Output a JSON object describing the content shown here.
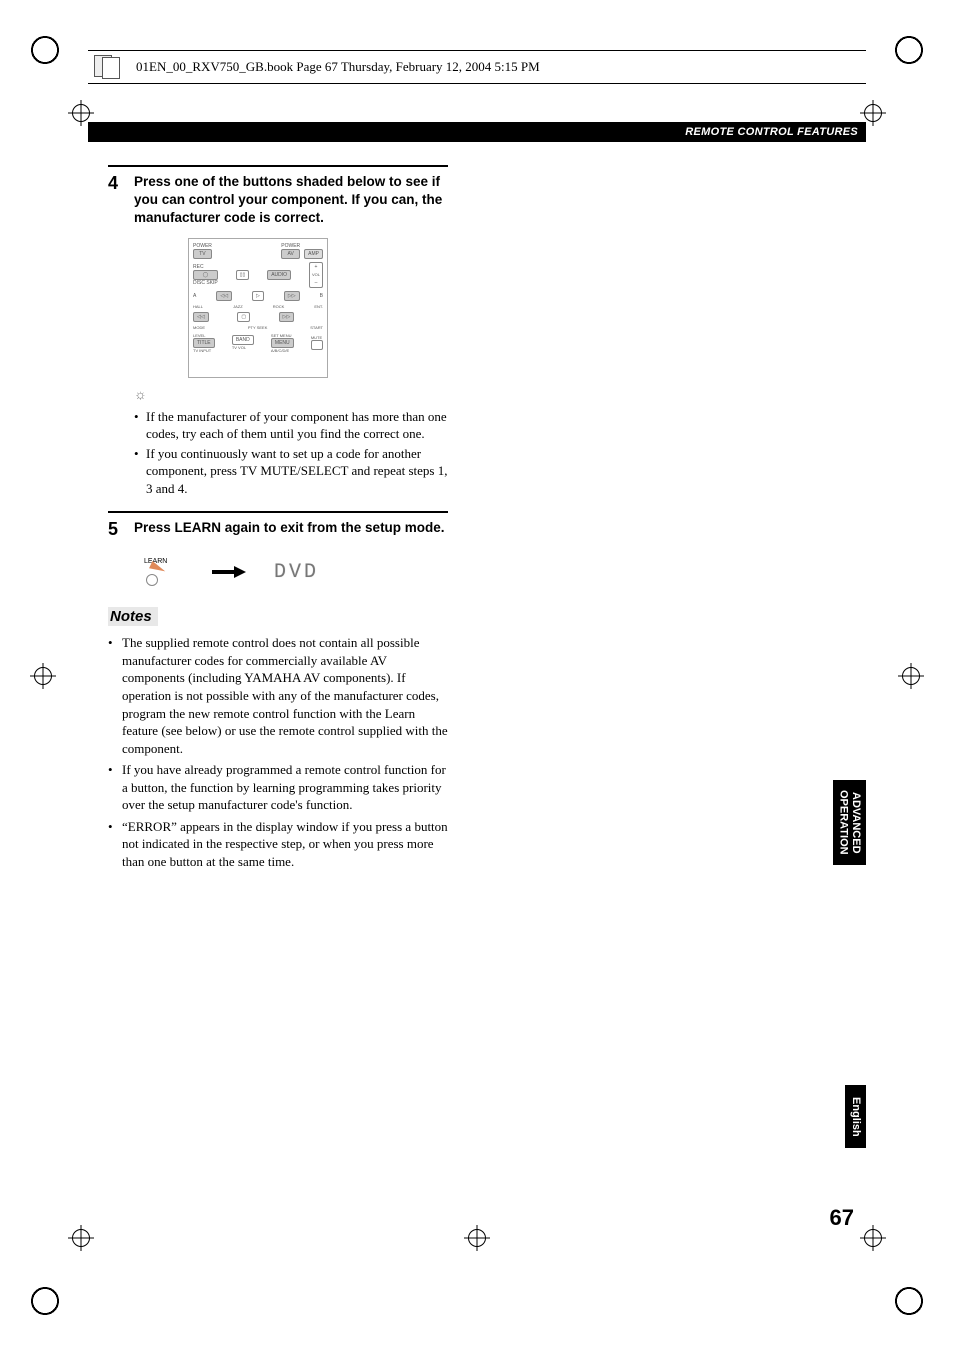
{
  "header": {
    "file_info": "01EN_00_RXV750_GB.book  Page 67  Thursday, February 12, 2004  5:15 PM"
  },
  "banner": {
    "section_title": "REMOTE CONTROL FEATURES"
  },
  "steps": {
    "four": {
      "num": "4",
      "text": "Press one of the buttons shaded below to see if you can control your component. If you can, the manufacturer code is correct."
    },
    "five": {
      "num": "5",
      "text": "Press LEARN again to exit from the setup mode."
    }
  },
  "remote": {
    "power_label": "POWER",
    "tv": "TV",
    "av": "AV",
    "amp": "AMP",
    "rec": "REC",
    "disc_skip": "DISC SKIP",
    "audio": "AUDIO",
    "vol": "VOL",
    "plus": "+",
    "minus": "–",
    "a": "A",
    "b": "B",
    "hall": "HALL",
    "jazz": "JAZZ",
    "rock": "ROCK",
    "ent": "ENT.",
    "mode": "MODE",
    "ptypsm": "PTY SEEK",
    "start": "START",
    "level": "LEVEL",
    "title": "TITLE",
    "band": "BAND",
    "tvvol": "TV VOL",
    "setmenu": "SET MENU",
    "menu": "MENU",
    "mute": "MUTE",
    "tvinput": "TV INPUT",
    "abcde": "A/B/C/D/E"
  },
  "tips": {
    "t1": "If the manufacturer of your component has more than one codes, try each of them until you find the correct one.",
    "t2": "If you continuously want to set up a code for another component, press TV MUTE/SELECT and repeat steps 1, 3 and 4."
  },
  "learn": {
    "label": "LEARN",
    "display": "DVD"
  },
  "notes": {
    "heading": "Notes",
    "n1": "The supplied remote control does not contain all possible manufacturer codes for commercially available AV components (including YAMAHA AV components). If operation is not possible with any of the manufacturer codes, program the new remote control function with the Learn feature (see below) or use the remote control supplied with the component.",
    "n2": "If you have already programmed a remote control function for a button, the function by learning programming takes priority over the setup manufacturer code's function.",
    "n3": "“ERROR” appears in the display window if you press a button not indicated in the respective step, or when you press more than one button at the same time."
  },
  "side": {
    "tab1_line1": "ADVANCED",
    "tab1_line2": "OPERATION",
    "tab2": "English"
  },
  "page_number": "67"
}
